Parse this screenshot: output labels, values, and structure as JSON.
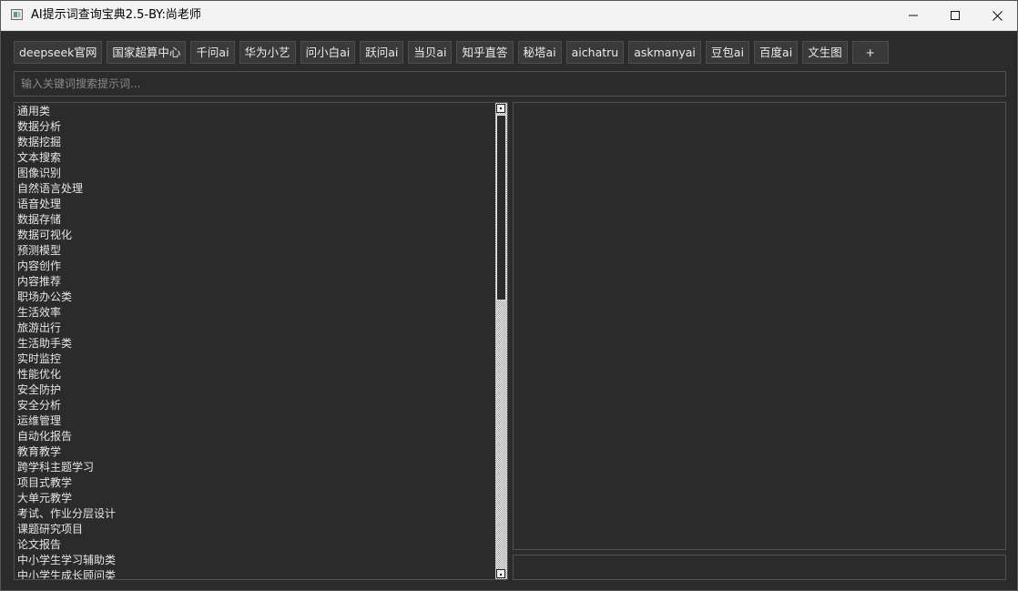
{
  "window": {
    "title": "AI提示词查询宝典2.5-BY:尚老师",
    "minimize_glyph": "—",
    "maximize_glyph": "☐",
    "close_glyph": "✕"
  },
  "toolbar": {
    "buttons": [
      {
        "label": "deepseek官网"
      },
      {
        "label": "国家超算中心"
      },
      {
        "label": "千问ai"
      },
      {
        "label": "华为小艺"
      },
      {
        "label": "问小白ai"
      },
      {
        "label": "跃问ai"
      },
      {
        "label": "当贝ai"
      },
      {
        "label": "知乎直答"
      },
      {
        "label": "秘塔ai"
      },
      {
        "label": "aichatru"
      },
      {
        "label": "askmanyai"
      },
      {
        "label": "豆包ai"
      },
      {
        "label": "百度ai"
      },
      {
        "label": "文生图"
      },
      {
        "label": "+"
      }
    ]
  },
  "search": {
    "placeholder": "输入关键词搜索提示词...",
    "value": ""
  },
  "categories": [
    "通用类",
    "数据分析",
    "数据挖掘",
    "文本搜索",
    "图像识别",
    "自然语言处理",
    "语音处理",
    "数据存储",
    "数据可视化",
    "预测模型",
    "内容创作",
    "内容推荐",
    "职场办公类",
    "生活效率",
    "旅游出行",
    "生活助手类",
    "实时监控",
    "性能优化",
    "安全防护",
    "安全分析",
    "运维管理",
    "自动化报告",
    "教育教学",
    "跨学科主题学习",
    "项目式教学",
    "大单元教学",
    "考试、作业分层设计",
    "课题研究项目",
    "论文报告",
    "中小学生学习辅助类",
    "中小学生成长顾问类"
  ],
  "scrollbar": {
    "position_fraction": 0.0,
    "visible_fraction": 0.41
  },
  "detail": {
    "content": ""
  },
  "bottom_field": {
    "value": ""
  },
  "icons": {
    "app": "app-window-icon",
    "minimize": "minimize-icon",
    "maximize": "maximize-icon",
    "close": "close-icon"
  }
}
